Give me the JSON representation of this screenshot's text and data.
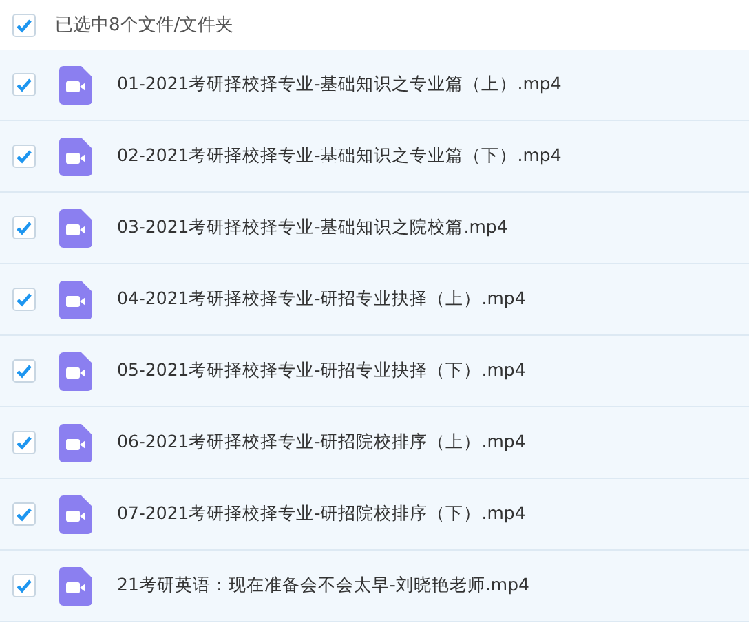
{
  "header": {
    "label": "已选中8个文件/文件夹",
    "checked": true
  },
  "files": [
    {
      "name": "01-2021考研择校择专业-基础知识之专业篇（上）.mp4",
      "checked": true
    },
    {
      "name": "02-2021考研择校择专业-基础知识之专业篇（下）.mp4",
      "checked": true
    },
    {
      "name": "03-2021考研择校择专业-基础知识之院校篇.mp4",
      "checked": true
    },
    {
      "name": "04-2021考研择校择专业-研招专业抉择（上）.mp4",
      "checked": true
    },
    {
      "name": "05-2021考研择校择专业-研招专业抉择（下）.mp4",
      "checked": true
    },
    {
      "name": "06-2021考研择校择专业-研招院校排序（上）.mp4",
      "checked": true
    },
    {
      "name": "07-2021考研择校择专业-研招院校排序（下）.mp4",
      "checked": true
    },
    {
      "name": "21考研英语：现在准备会不会太早-刘晓艳老师.mp4",
      "checked": true
    }
  ]
}
